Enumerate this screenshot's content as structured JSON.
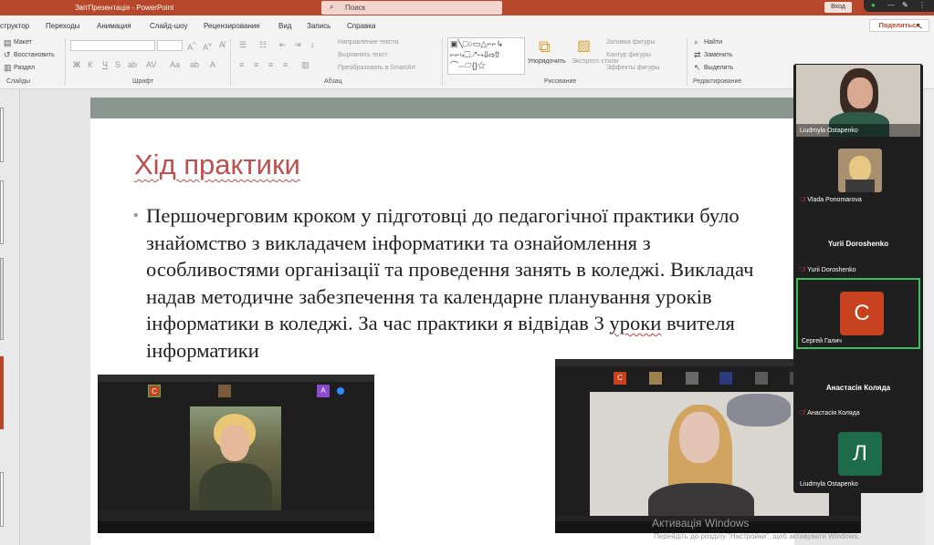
{
  "app": {
    "title": "ЗвітПрезентація  -  PowerPoint",
    "search_placeholder": "Поиск",
    "login_label": "Вход",
    "share_label": "Поделиться",
    "accent_color": "#b7472a"
  },
  "tabs": [
    "структор",
    "Переходы",
    "Анимация",
    "Слайд-шоу",
    "Рецензирование",
    "Вид",
    "Запись",
    "Справка"
  ],
  "ribbon": {
    "slides": {
      "layout": "Макет",
      "reset": "Восстановить",
      "section": "Раздел",
      "group": "Слайды"
    },
    "font": {
      "group": "Шрифт"
    },
    "paragraph": {
      "text_direction": "Направление текста",
      "align_text": "Выровнять текст",
      "smartart": "Преобразовать в SmartArt",
      "group": "Абзац"
    },
    "drawing": {
      "arrange": "Упорядочить",
      "quick_styles": "Экспресс-стили",
      "fill": "Заливка фигуры",
      "outline": "Контур фигуры",
      "effects": "Эффекты фигуры",
      "group": "Рисование"
    },
    "editing": {
      "find": "Найти",
      "replace": "Заменить",
      "select": "Выделить",
      "group": "Редактирование"
    }
  },
  "slide": {
    "heading": "Хід практики",
    "lines": [
      "Першочерговим кроком у підготовці до педагогічної практики було",
      "знайомство з викладачем інформатики та ознайомлення з",
      "особливостями організації та проведення занять в коледжі. Викладач",
      "надав методичне забезпечення та календарне планування уроків",
      "інформатики в коледжі. За час практики я відвідав 3"
    ],
    "line5_underlined": "уроки",
    "line5_tail": " вчителя",
    "line6": "інформатики",
    "band_color": "#8a9790",
    "heading_color": "#c0504d"
  },
  "participants": [
    {
      "name": "Liudmyla Ostapenko",
      "type": "video",
      "muted": false
    },
    {
      "name": "Vlada Ponomarova",
      "type": "photo",
      "muted": true
    },
    {
      "name": "Yurii Doroshenko",
      "type": "name",
      "muted": true
    },
    {
      "name": "Сергей Галич",
      "type": "avatar",
      "letter": "С",
      "color": "#c8421f",
      "muted": false
    },
    {
      "name": "Анастасія Коляда",
      "type": "name",
      "muted": true
    },
    {
      "name": "Liudmyla Ostapenko",
      "type": "avatar",
      "letter": "Л",
      "color": "#1e6b4a",
      "muted": false
    }
  ],
  "activation": {
    "title": "Активація Windows",
    "hint": "Перейдіть до розділу \"Настройки\", щоб активувати Windows."
  }
}
